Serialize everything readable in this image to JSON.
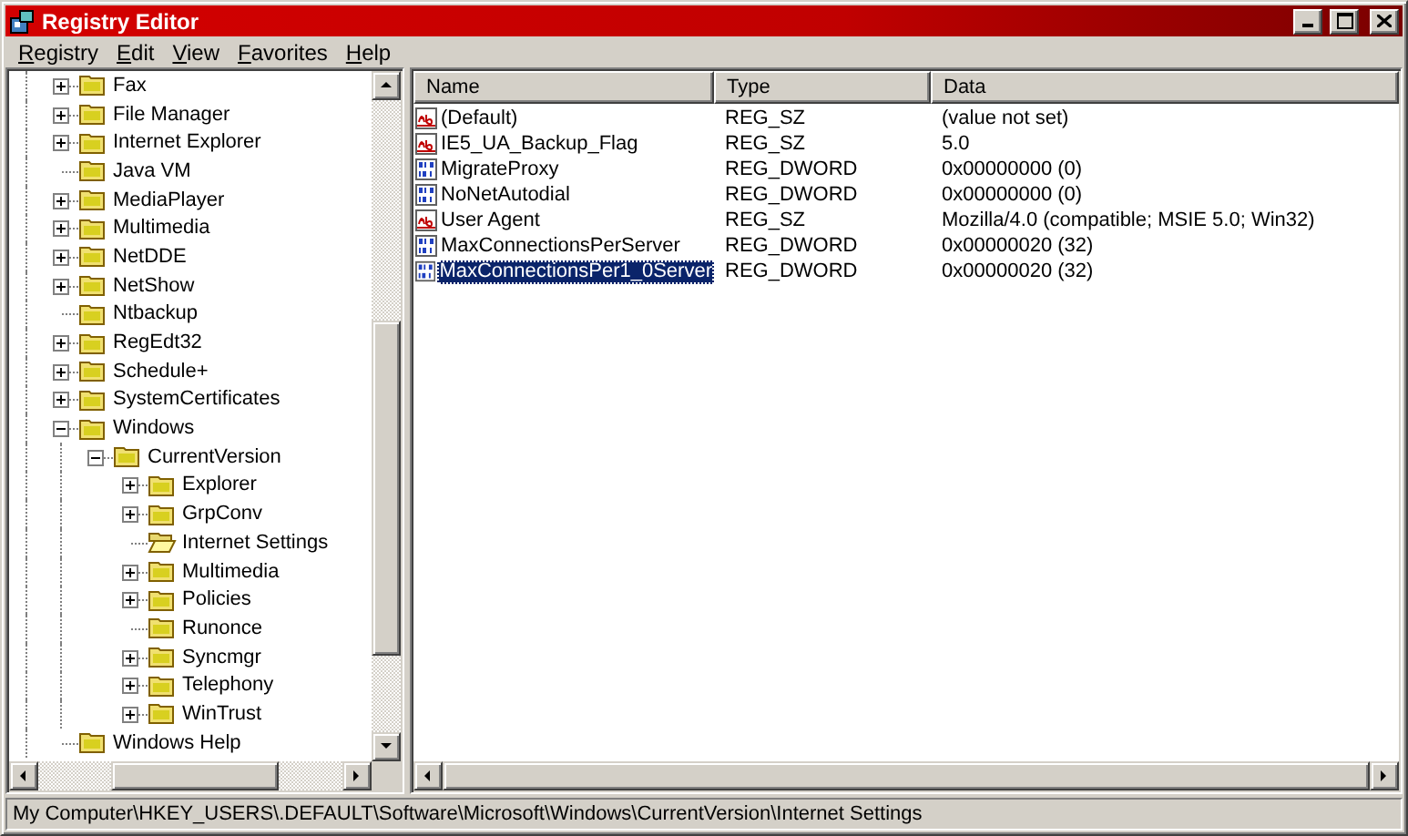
{
  "window": {
    "title": "Registry Editor"
  },
  "menu": [
    "Registry",
    "Edit",
    "View",
    "Favorites",
    "Help"
  ],
  "tree": [
    {
      "label": "Fax",
      "expanded": false,
      "selected": false
    },
    {
      "label": "File Manager",
      "expanded": false,
      "selected": false
    },
    {
      "label": "Internet Explorer",
      "expanded": false,
      "selected": false
    },
    {
      "label": "Java VM",
      "selected": false
    },
    {
      "label": "MediaPlayer",
      "expanded": false,
      "selected": false
    },
    {
      "label": "Multimedia",
      "expanded": false,
      "selected": false
    },
    {
      "label": "NetDDE",
      "expanded": false,
      "selected": false
    },
    {
      "label": "NetShow",
      "expanded": false,
      "selected": false
    },
    {
      "label": "Ntbackup",
      "selected": false
    },
    {
      "label": "RegEdt32",
      "expanded": false,
      "selected": false
    },
    {
      "label": "Schedule+",
      "expanded": false,
      "selected": false
    },
    {
      "label": "SystemCertificates",
      "expanded": false,
      "selected": false
    },
    {
      "label": "Windows",
      "expanded": true,
      "selected": false,
      "children": [
        {
          "label": "CurrentVersion",
          "expanded": true,
          "selected": false,
          "children": [
            {
              "label": "Explorer",
              "expanded": false,
              "selected": false
            },
            {
              "label": "GrpConv",
              "expanded": false,
              "selected": false
            },
            {
              "label": "Internet Settings",
              "selected": true
            },
            {
              "label": "Multimedia",
              "expanded": false,
              "selected": false
            },
            {
              "label": "Policies",
              "expanded": false,
              "selected": false
            },
            {
              "label": "Runonce",
              "selected": false
            },
            {
              "label": "Syncmgr",
              "expanded": false,
              "selected": false
            },
            {
              "label": "Telephony",
              "expanded": false,
              "selected": false
            },
            {
              "label": "WinTrust",
              "expanded": false,
              "selected": false
            }
          ]
        }
      ]
    },
    {
      "label": "Windows Help",
      "selected": false
    }
  ],
  "list": {
    "columns": [
      "Name",
      "Type",
      "Data"
    ],
    "rows": [
      {
        "name": "(Default)",
        "kind": "string",
        "type": "REG_SZ",
        "data": "(value not set)",
        "selected": false
      },
      {
        "name": "IE5_UA_Backup_Flag",
        "kind": "string",
        "type": "REG_SZ",
        "data": "5.0",
        "selected": false
      },
      {
        "name": "MigrateProxy",
        "kind": "dword",
        "type": "REG_DWORD",
        "data": "0x00000000 (0)",
        "selected": false
      },
      {
        "name": "NoNetAutodial",
        "kind": "dword",
        "type": "REG_DWORD",
        "data": "0x00000000 (0)",
        "selected": false
      },
      {
        "name": "User Agent",
        "kind": "string",
        "type": "REG_SZ",
        "data": "Mozilla/4.0 (compatible; MSIE 5.0; Win32)",
        "selected": false
      },
      {
        "name": "MaxConnectionsPerServer",
        "kind": "dword",
        "type": "REG_DWORD",
        "data": "0x00000020 (32)",
        "selected": false
      },
      {
        "name": "MaxConnectionsPer1_0Server",
        "kind": "dword",
        "type": "REG_DWORD",
        "data": "0x00000020 (32)",
        "selected": true
      }
    ]
  },
  "status_bar": "My Computer\\HKEY_USERS\\.DEFAULT\\Software\\Microsoft\\Windows\\CurrentVersion\\Internet Settings"
}
